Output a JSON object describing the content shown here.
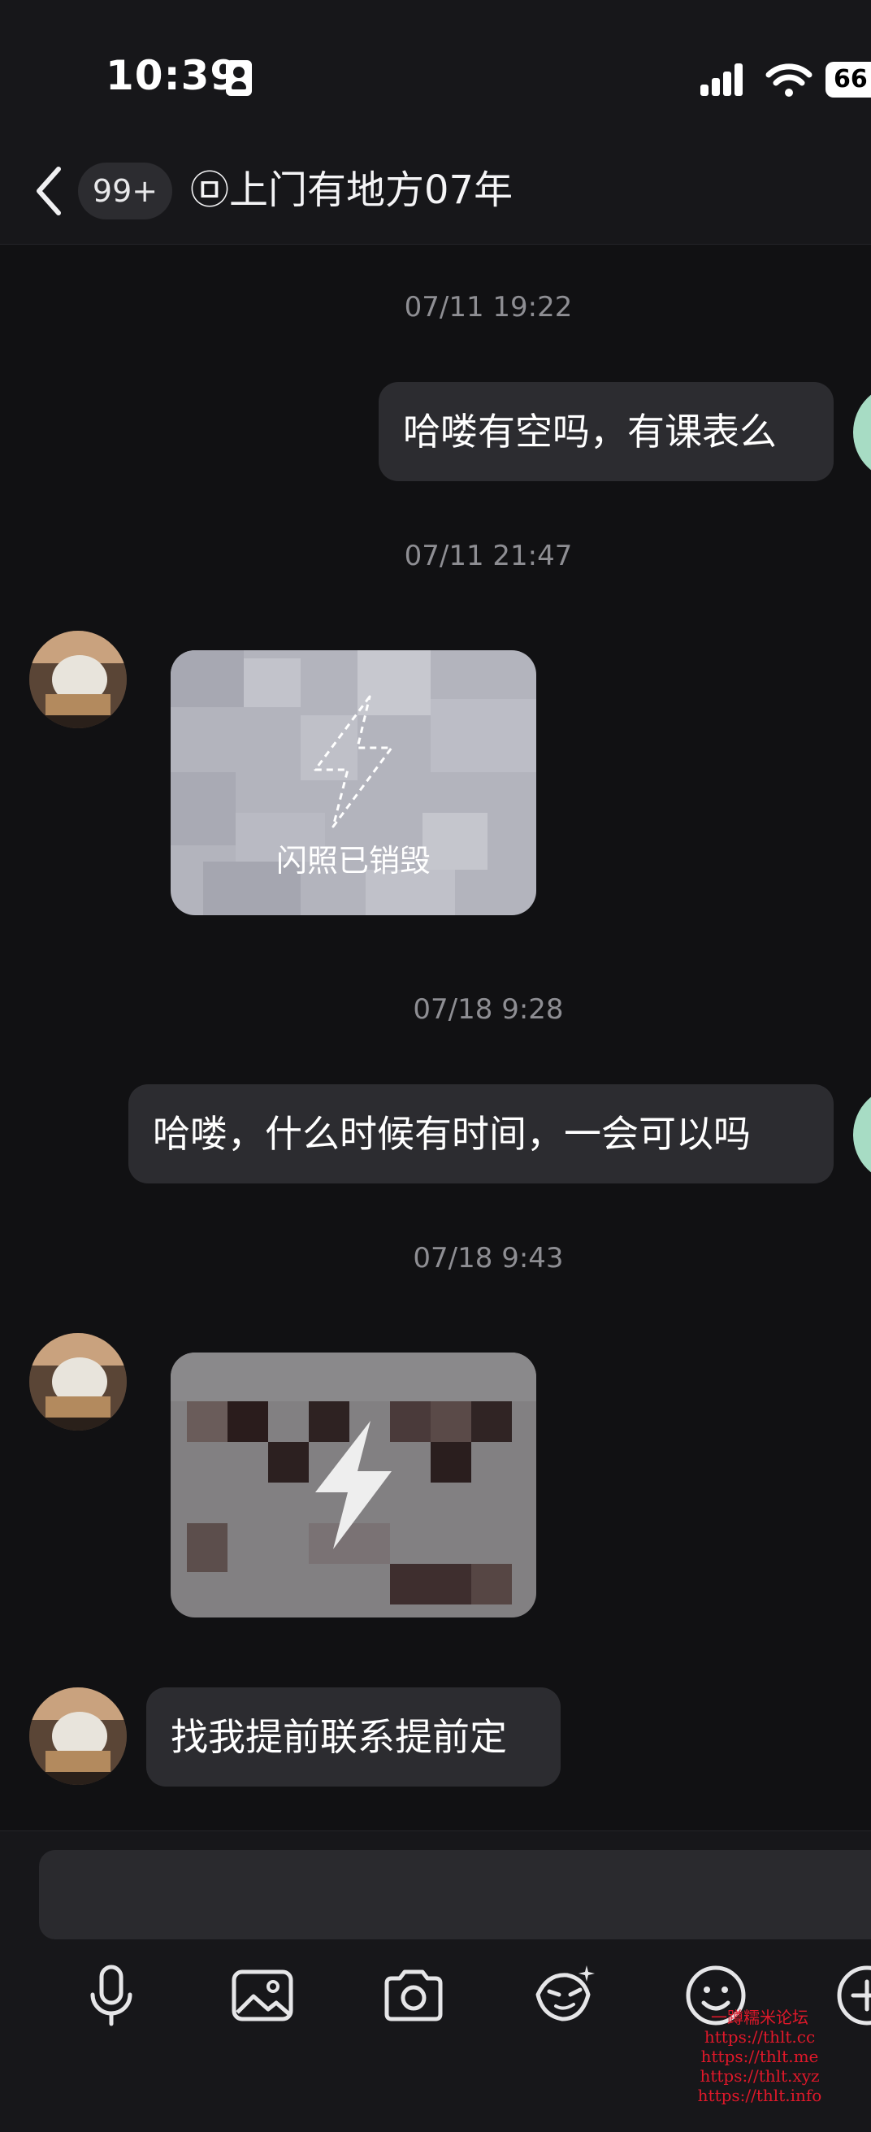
{
  "status_bar": {
    "time": "10:39",
    "battery": "66"
  },
  "header": {
    "unread_count": "99+",
    "title": "㉤上门有地方07年"
  },
  "messages": [
    {
      "type": "timestamp",
      "text": "07/11 19:22"
    },
    {
      "type": "text",
      "side": "right",
      "text": "哈喽有空吗，有课表么"
    },
    {
      "type": "timestamp",
      "text": "07/11 21:47"
    },
    {
      "type": "flash_photo",
      "side": "left",
      "state": "destroyed",
      "label": "闪照已销毁"
    },
    {
      "type": "timestamp",
      "text": "07/18 9:28"
    },
    {
      "type": "text",
      "side": "right",
      "text": "哈喽，什么时候有时间，一会可以吗"
    },
    {
      "type": "timestamp",
      "text": "07/18 9:43"
    },
    {
      "type": "flash_photo",
      "side": "left",
      "state": "unopened"
    },
    {
      "type": "text",
      "side": "left",
      "text": "找我提前联系提前定"
    }
  ],
  "composer": {
    "placeholder": "",
    "tools": [
      "microphone-icon",
      "image-icon",
      "camera-icon",
      "sticker-icon",
      "emoji-icon",
      "plus-icon"
    ]
  },
  "watermark": {
    "lines": [
      "一蹲糯米论坛",
      "https://thlt.cc",
      "https://thlt.me",
      "https://thlt.xyz",
      "https://thlt.info"
    ],
    "color": "#e0182a"
  },
  "colors": {
    "background": "#111113",
    "bubble": "#2c2c30",
    "self_avatar_accent": "#a7dcc4",
    "timestamp": "#8e8e93"
  }
}
